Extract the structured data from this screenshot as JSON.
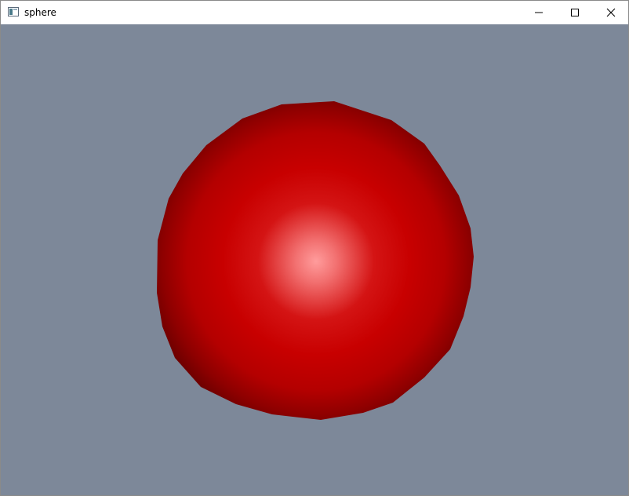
{
  "window": {
    "title": "sphere",
    "icon": "app-window-icon",
    "controls": {
      "minimize_icon": "minimize-icon",
      "maximize_icon": "maximize-icon",
      "close_icon": "close-icon"
    }
  },
  "scene": {
    "background_color": "#7d8899",
    "object": "sphere",
    "sphere_color": "#c80000",
    "highlight_color": "#ff9c9c",
    "shadow_color": "#6e0000"
  }
}
